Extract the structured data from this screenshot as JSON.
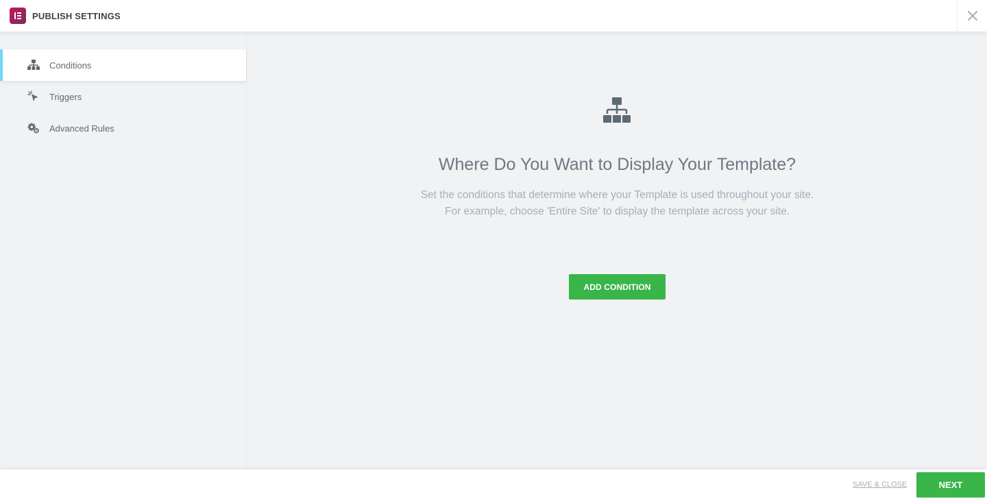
{
  "header": {
    "title": "PUBLISH SETTINGS",
    "logo_icon": "elementor-logo-icon",
    "close_icon": "close-icon"
  },
  "sidebar": {
    "items": [
      {
        "label": "Conditions",
        "icon": "sitemap-icon",
        "active": true
      },
      {
        "label": "Triggers",
        "icon": "cursor-click-icon",
        "active": false
      },
      {
        "label": "Advanced Rules",
        "icon": "gears-icon",
        "active": false
      }
    ]
  },
  "main": {
    "icon": "sitemap-icon",
    "heading": "Where Do You Want to Display Your Template?",
    "description_line1": "Set the conditions that determine where your Template is used throughout your site.",
    "description_line2": "For example, choose 'Entire Site' to display the template across your site.",
    "add_button_label": "ADD CONDITION"
  },
  "footer": {
    "save_close_label": "SAVE & CLOSE",
    "next_label": "NEXT"
  },
  "colors": {
    "accent_green": "#39b54a",
    "active_indicator": "#71d7f7",
    "logo": "#92003b"
  }
}
